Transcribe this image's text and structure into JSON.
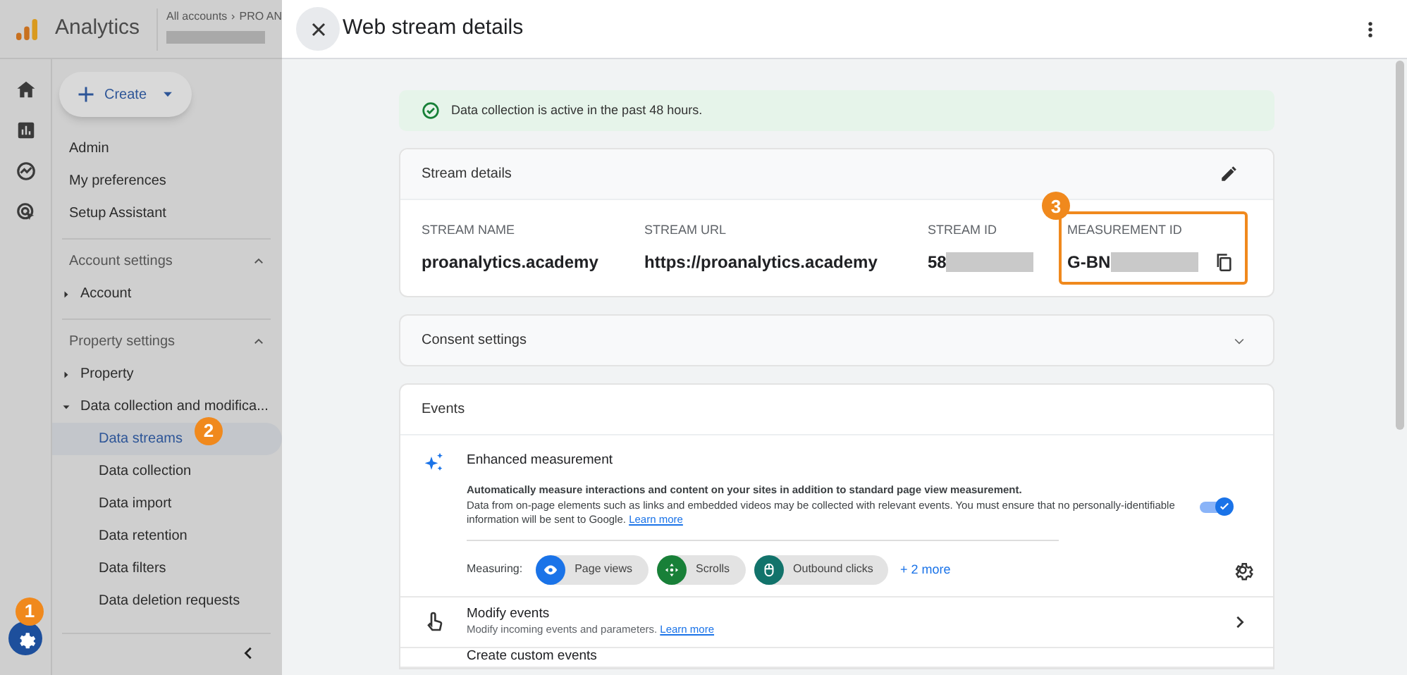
{
  "app": {
    "name": "Analytics",
    "breadcrumb": [
      "All accounts",
      "PRO AN"
    ]
  },
  "create_button": {
    "label": "Create"
  },
  "nav": {
    "top_items": [
      {
        "label": "Admin",
        "selected": false
      },
      {
        "label": "My preferences",
        "selected": false
      },
      {
        "label": "Setup Assistant",
        "selected": false
      }
    ],
    "sections": [
      {
        "title": "Account settings",
        "expanded": true,
        "items": [
          {
            "label": "Account",
            "expanded": false
          }
        ]
      },
      {
        "title": "Property settings",
        "expanded": true,
        "items": [
          {
            "label": "Property",
            "expanded": false
          },
          {
            "label": "Data collection and modifica...",
            "expanded": true,
            "children": [
              {
                "label": "Data streams",
                "selected": true,
                "badge": "2"
              },
              {
                "label": "Data collection",
                "selected": false
              },
              {
                "label": "Data import",
                "selected": false
              },
              {
                "label": "Data retention",
                "selected": false
              },
              {
                "label": "Data filters",
                "selected": false
              },
              {
                "label": "Data deletion requests",
                "selected": false
              }
            ]
          }
        ]
      }
    ]
  },
  "settings_button": {
    "badge": "1"
  },
  "drawer": {
    "title": "Web stream details",
    "alert": "Data collection is active in the past 48 hours.",
    "stream_details": {
      "title": "Stream details",
      "fields": [
        {
          "label": "STREAM NAME",
          "value": "proanalytics.academy",
          "redacted": false,
          "highlighted": false
        },
        {
          "label": "STREAM URL",
          "value": "https://proanalytics.academy",
          "redacted": false,
          "highlighted": false
        },
        {
          "label": "STREAM ID",
          "value": "58",
          "redacted": true,
          "highlighted": false
        },
        {
          "label": "MEASUREMENT ID",
          "value": "G-BN",
          "redacted": true,
          "highlighted": true,
          "badge": "3"
        }
      ]
    },
    "consent": {
      "title": "Consent settings",
      "expanded": false
    },
    "events": {
      "title": "Events",
      "enhanced": {
        "title": "Enhanced measurement",
        "description_1": "Automatically measure interactions and content on your sites in addition to standard page view measurement.",
        "description_2": "Data from on-page elements such as links and embedded videos may be collected with relevant events. You must ensure that no personally-identifiable information will be sent to Google.",
        "link": "Learn more",
        "on": true,
        "measuring_label": "Measuring:",
        "chips": [
          {
            "label": "Page views",
            "kind": "eye",
            "color": "#1a73e8"
          },
          {
            "label": "Scrolls",
            "kind": "move",
            "color": "#188038"
          },
          {
            "label": "Outbound clicks",
            "kind": "mouse",
            "color": "#12736b"
          }
        ],
        "more": "+ 2 more"
      },
      "rows": [
        {
          "title": "Modify events",
          "description": "Modify incoming events and parameters.",
          "link": "Learn more"
        },
        {
          "title": "Create custom events"
        }
      ]
    }
  }
}
